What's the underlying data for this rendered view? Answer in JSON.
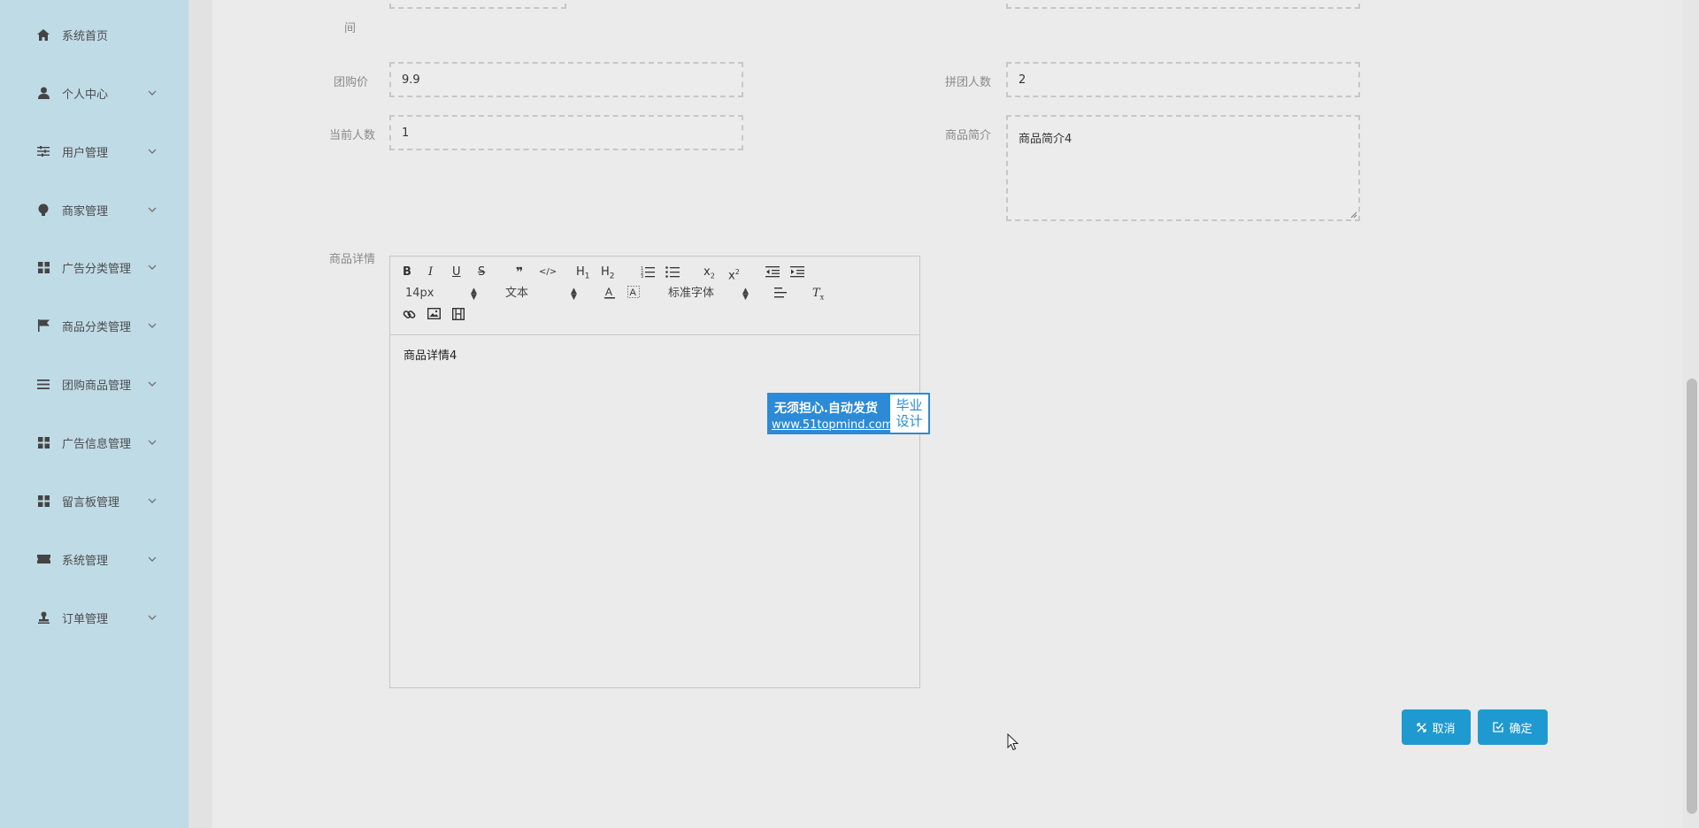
{
  "sidebar": {
    "items": [
      {
        "label": "系统首页",
        "icon": "home-icon",
        "has_chevron": false
      },
      {
        "label": "个人中心",
        "icon": "user-icon",
        "has_chevron": true
      },
      {
        "label": "用户管理",
        "icon": "sliders-icon",
        "has_chevron": true
      },
      {
        "label": "商家管理",
        "icon": "bulb-icon",
        "has_chevron": true
      },
      {
        "label": "广告分类管理",
        "icon": "grid-icon",
        "has_chevron": true
      },
      {
        "label": "商品分类管理",
        "icon": "flag-icon",
        "has_chevron": true
      },
      {
        "label": "团购商品管理",
        "icon": "list-icon",
        "has_chevron": true
      },
      {
        "label": "广告信息管理",
        "icon": "grid-icon",
        "has_chevron": true
      },
      {
        "label": "留言板管理",
        "icon": "grid-icon",
        "has_chevron": true
      },
      {
        "label": "系统管理",
        "icon": "ticket-icon",
        "has_chevron": true
      },
      {
        "label": "订单管理",
        "icon": "stamp-icon",
        "has_chevron": true
      }
    ]
  },
  "form": {
    "partial_label": "间",
    "group_price": {
      "label": "团购价",
      "value": "9.9"
    },
    "group_size": {
      "label": "拼团人数",
      "value": "2"
    },
    "current_count": {
      "label": "当前人数",
      "value": "1"
    },
    "intro": {
      "label": "商品简介",
      "value": "商品简介4"
    },
    "detail": {
      "label": "商品详情",
      "value": "商品详情4"
    }
  },
  "editor": {
    "font_size": "14px",
    "block_type": "文本",
    "font_family": "标准字体",
    "buttons": [
      "B",
      "I",
      "U",
      "S",
      "❞",
      "</>",
      "H1",
      "H2",
      "ordered-list",
      "unordered-list",
      "x₂",
      "x²",
      "outdent",
      "indent"
    ]
  },
  "watermark": {
    "line1": "无须担心.自动发货",
    "line2": "www.51topmind.com",
    "right_line1": "毕业",
    "right_line2": "设计"
  },
  "actions": {
    "cancel_label": "取消",
    "confirm_label": "确定"
  },
  "colors": {
    "sidebar_bg": "#bfdbe6",
    "main_bg": "#ebebeb",
    "button_bg": "#1f9ad0",
    "watermark_bg": "#2c8ad6"
  }
}
